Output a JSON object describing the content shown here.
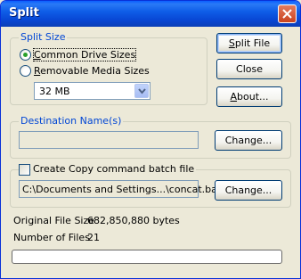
{
  "window": {
    "title": "Split"
  },
  "split_size": {
    "legend": "Split Size",
    "option_common": {
      "label": "Common Drive Sizes",
      "selected": true
    },
    "option_removable": {
      "label": "Removable Media Sizes",
      "selected": false
    },
    "size_select": {
      "value": "32 MB"
    }
  },
  "destination": {
    "legend": "Destination Name(s)",
    "value": "",
    "change_label": "Change..."
  },
  "batch": {
    "checkbox_label": "Create Copy command batch file",
    "checked": false,
    "path": "C:\\Documents and Settings...\\concat.bat",
    "change_label": "Change..."
  },
  "buttons": {
    "split_file": "Split File",
    "close": "Close",
    "about": "About..."
  },
  "info": {
    "original_size_label": "Original File Size",
    "original_size_value": "682,850,880 bytes",
    "num_files_label": "Number of Files",
    "num_files_value": "21"
  },
  "progress": {
    "fraction": 0
  }
}
